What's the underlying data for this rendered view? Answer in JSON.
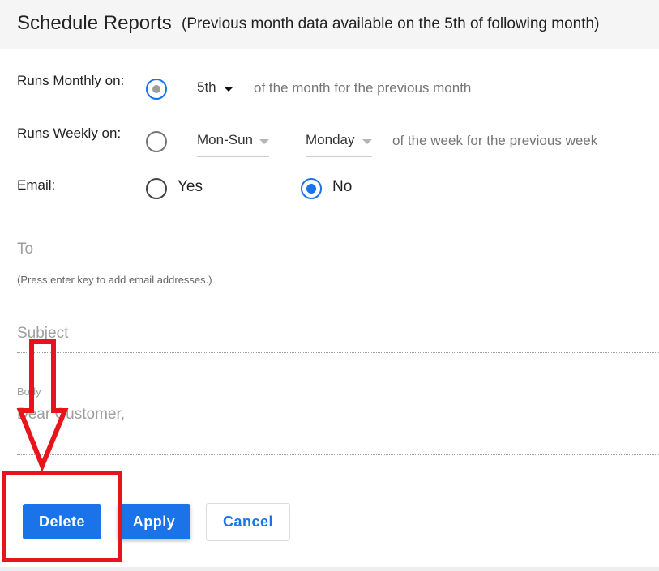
{
  "header": {
    "title": "Schedule Reports",
    "subtitle": "(Previous month data available on the 5th of following month)"
  },
  "monthly": {
    "label": "Runs Monthly on:",
    "day_value": "5th",
    "suffix": "of the month for the previous month",
    "selected": true
  },
  "weekly": {
    "label": "Runs Weekly on:",
    "range_value": "Mon-Sun",
    "day_value": "Monday",
    "suffix": "of the week for the previous week",
    "selected": false
  },
  "email": {
    "label": "Email:",
    "options": [
      {
        "label": "Yes",
        "selected": false
      },
      {
        "label": "No",
        "selected": true
      }
    ]
  },
  "to_field": {
    "label": "To",
    "hint": "(Press enter key to add email addresses.)"
  },
  "subject_field": {
    "label": "Subject"
  },
  "body_field": {
    "label": "Body",
    "value": "Dear Customer,"
  },
  "buttons": {
    "delete": "Delete",
    "apply": "Apply",
    "cancel": "Cancel"
  },
  "colors": {
    "accent": "#1a73e8",
    "highlight": "#e8141c",
    "header_bg": "#f5f5f5"
  },
  "icons": [
    "radio-icon",
    "caret-down-icon",
    "down-arrow-annotation"
  ]
}
